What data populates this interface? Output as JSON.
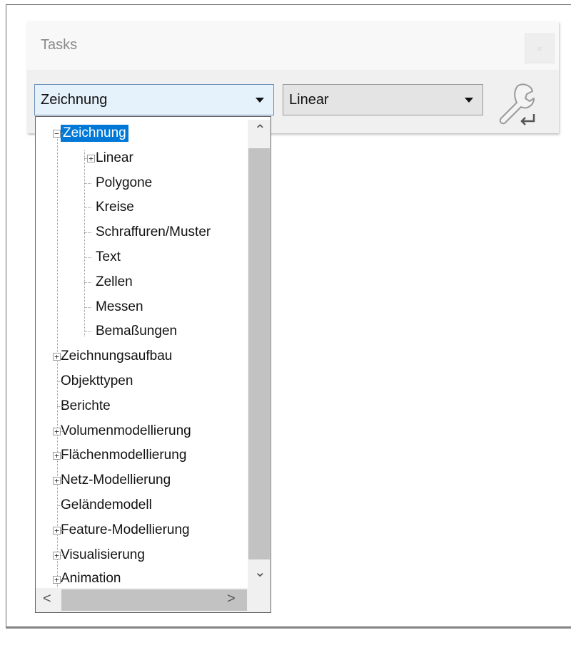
{
  "panel": {
    "title": "Tasks",
    "close_glyph": "×"
  },
  "combos": {
    "main": {
      "value": "Zeichnung"
    },
    "sub": {
      "value": "Linear"
    },
    "settings_icon": "wrench-icon"
  },
  "tree": {
    "items": [
      {
        "label": "Zeichnung",
        "level": 0,
        "expander": "minus",
        "selected": true
      },
      {
        "label": "Linear",
        "level": 1,
        "expander": "plus"
      },
      {
        "label": "Polygone",
        "level": 1
      },
      {
        "label": "Kreise",
        "level": 1
      },
      {
        "label": "Schraffuren/Muster",
        "level": 1
      },
      {
        "label": "Text",
        "level": 1
      },
      {
        "label": "Zellen",
        "level": 1
      },
      {
        "label": "Messen",
        "level": 1
      },
      {
        "label": "Bemaßungen",
        "level": 1
      },
      {
        "label": "Zeichnungsaufbau",
        "level": 0,
        "expander": "plus"
      },
      {
        "label": "Objekttypen",
        "level": 0
      },
      {
        "label": "Berichte",
        "level": 0
      },
      {
        "label": "Volumenmodellierung",
        "level": 0,
        "expander": "plus"
      },
      {
        "label": "Flächenmodellierung",
        "level": 0,
        "expander": "plus"
      },
      {
        "label": "Netz-Modellierung",
        "level": 0,
        "expander": "plus"
      },
      {
        "label": "Geländemodell",
        "level": 0
      },
      {
        "label": "Feature-Modellierung",
        "level": 0,
        "expander": "plus"
      },
      {
        "label": "Visualisierung",
        "level": 0,
        "expander": "plus"
      },
      {
        "label": "Animation",
        "level": 0,
        "expander": "plus"
      }
    ]
  },
  "scroll_glyphs": {
    "up": "⌃",
    "down": "⌄",
    "left": "<",
    "right": ">"
  },
  "colors": {
    "selection": "#0078d7",
    "combo_focus_bg": "#e5f1fb"
  }
}
